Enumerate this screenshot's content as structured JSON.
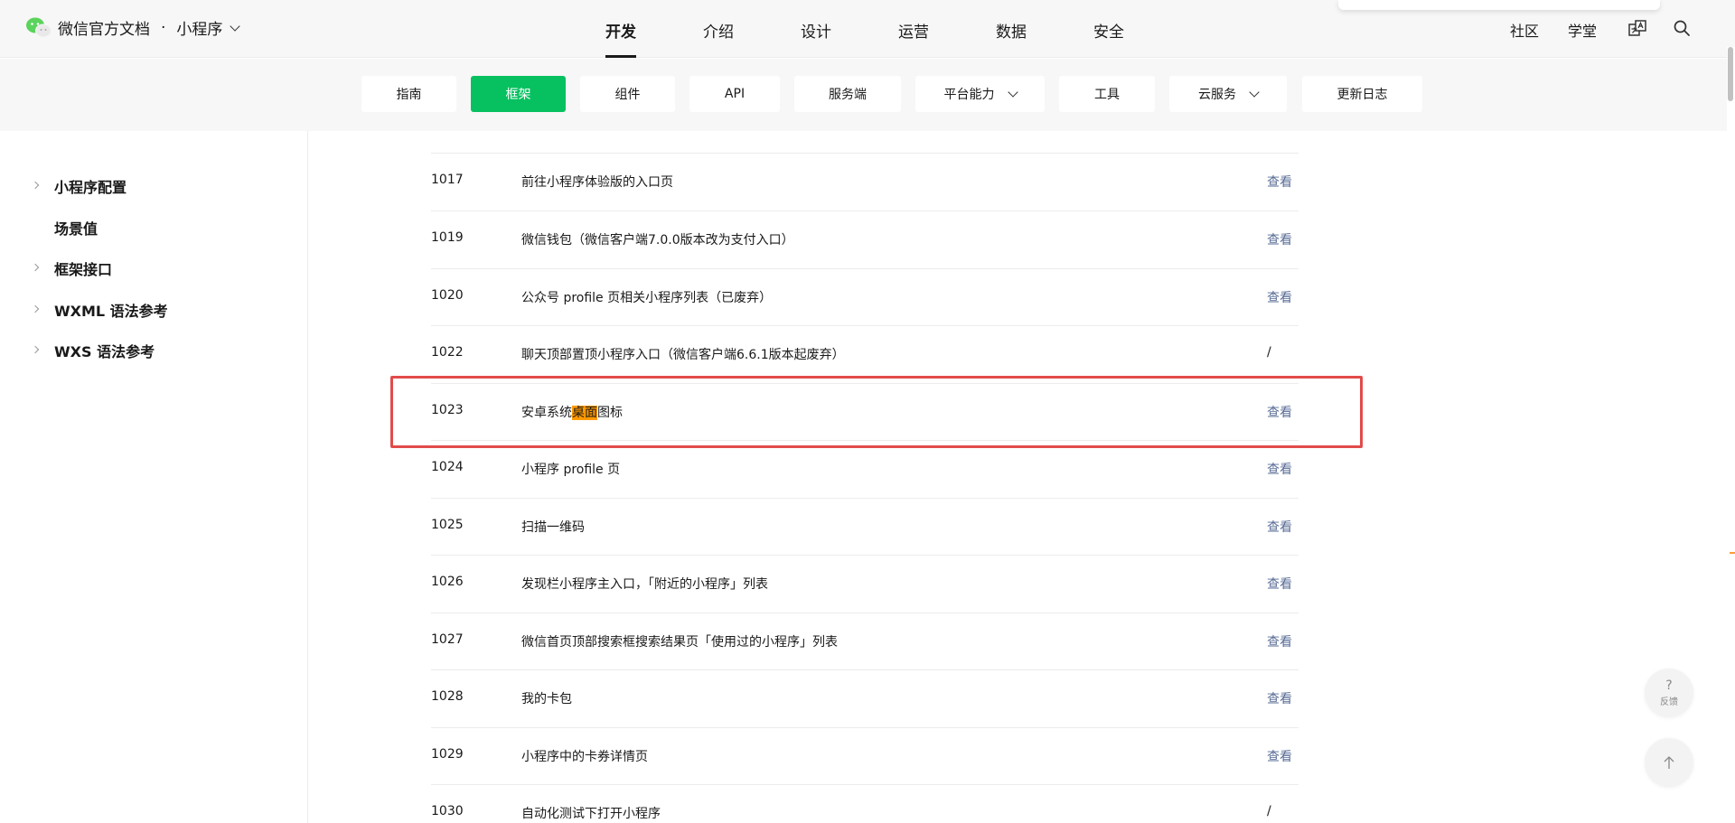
{
  "header": {
    "logo_text": "微信官方文档",
    "separator": "·",
    "product": "小程序",
    "main_nav": [
      "开发",
      "介绍",
      "设计",
      "运营",
      "数据",
      "安全"
    ],
    "active_nav": "开发",
    "right_nav": [
      "社区",
      "学堂"
    ]
  },
  "subnav": {
    "tabs": [
      {
        "label": "指南"
      },
      {
        "label": "框架"
      },
      {
        "label": "组件"
      },
      {
        "label": "API"
      },
      {
        "label": "服务端"
      },
      {
        "label": "平台能力"
      },
      {
        "label": "工具"
      },
      {
        "label": "云服务"
      },
      {
        "label": "更新日志"
      }
    ],
    "active": "框架"
  },
  "sidebar": {
    "items": [
      {
        "label": "小程序配置",
        "expandable": true
      },
      {
        "label": "场景值",
        "expandable": false
      },
      {
        "label": "框架接口",
        "expandable": true
      },
      {
        "label": "WXML 语法参考",
        "expandable": true
      },
      {
        "label": "WXS 语法参考",
        "expandable": true
      }
    ]
  },
  "table": {
    "rows": [
      {
        "code": "1017",
        "desc": "前往小程序体验版的入口页",
        "action": "查看"
      },
      {
        "code": "1019",
        "desc": "微信钱包（微信客户端7.0.0版本改为支付入口）",
        "action": "查看"
      },
      {
        "code": "1020",
        "desc": "公众号 profile 页相关小程序列表（已废弃）",
        "action": "查看"
      },
      {
        "code": "1022",
        "desc": "聊天顶部置顶小程序入口（微信客户端6.6.1版本起废弃）",
        "action": "/"
      },
      {
        "code": "1023",
        "desc_before": "安卓系统",
        "desc_highlight": "桌面",
        "desc_after": "图标",
        "action": "查看"
      },
      {
        "code": "1024",
        "desc": "小程序 profile 页",
        "action": "查看"
      },
      {
        "code": "1025",
        "desc": "扫描一维码",
        "action": "查看"
      },
      {
        "code": "1026",
        "desc": "发现栏小程序主入口，「附近的小程序」列表",
        "action": "查看"
      },
      {
        "code": "1027",
        "desc": "微信首页顶部搜索框搜索结果页「使用过的小程序」列表",
        "action": "查看"
      },
      {
        "code": "1028",
        "desc": "我的卡包",
        "action": "查看"
      },
      {
        "code": "1029",
        "desc": "小程序中的卡券详情页",
        "action": "查看"
      },
      {
        "code": "1030",
        "desc": "自动化测试下打开小程序",
        "action": "/"
      }
    ]
  },
  "floating": {
    "feedback_symbol": "?",
    "feedback_label": "反馈"
  },
  "colors": {
    "brand_green": "#07c160",
    "link": "#576b95",
    "highlight": "#ff9900",
    "annotation_box": "#e24b4b"
  }
}
